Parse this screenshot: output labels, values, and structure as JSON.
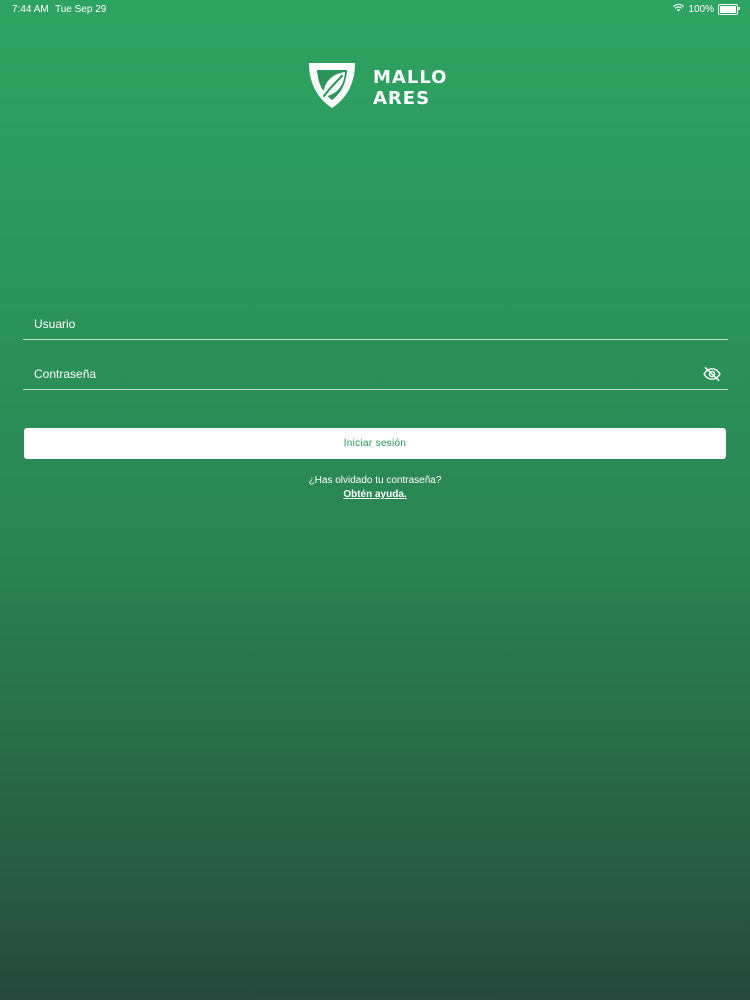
{
  "status_bar": {
    "time": "7:44 AM",
    "date": "Tue Sep 29",
    "battery_percent": "100%",
    "battery_level": 1.0
  },
  "logo": {
    "line1": "MALLO",
    "line2": "ARES",
    "icon": "shield-leaf-icon"
  },
  "form": {
    "username_placeholder": "Usuario",
    "password_placeholder": "Contraseña",
    "toggle_icon": "eye-slash-icon",
    "submit_label": "Iniciar sesión"
  },
  "help": {
    "question": "¿Has olvidado tu contraseña?",
    "link": "Obtén ayuda."
  },
  "colors": {
    "accent": "#2b9459",
    "gradient_top": "#2ea463",
    "gradient_bottom": "#27493e"
  }
}
